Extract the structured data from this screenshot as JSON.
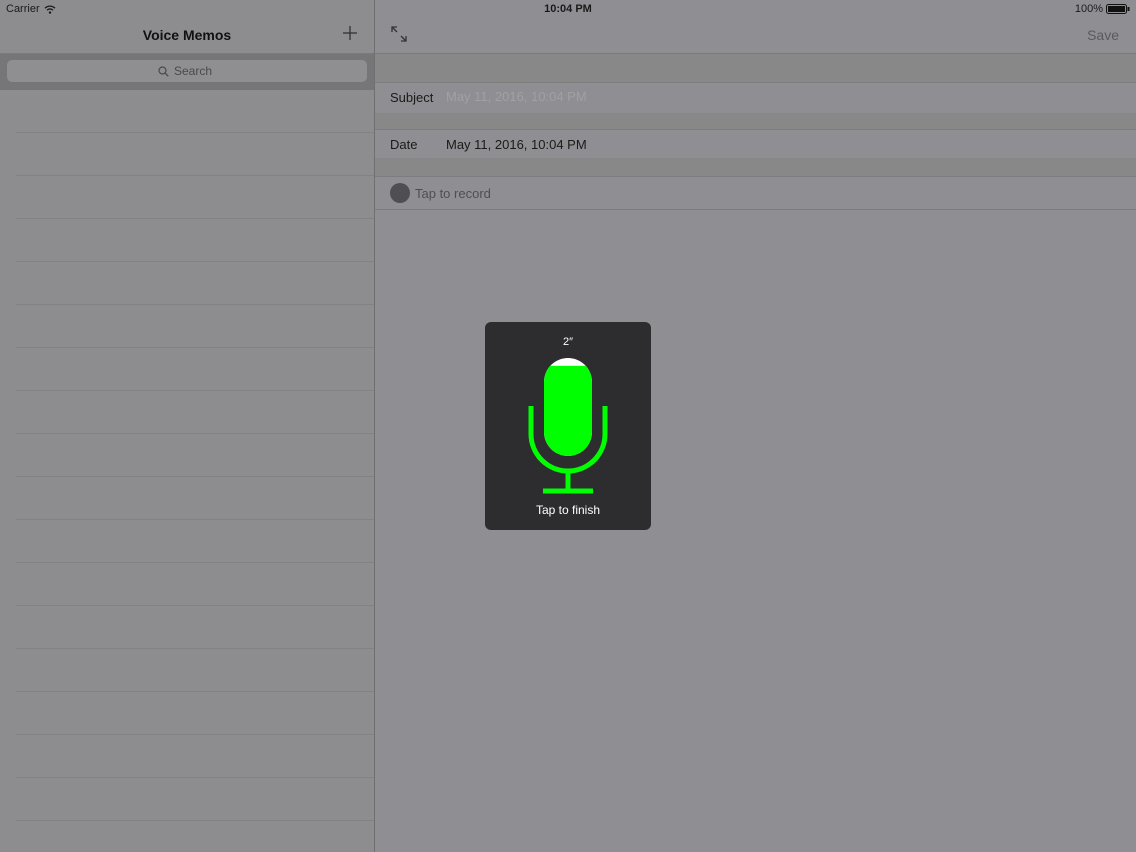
{
  "status_bar": {
    "carrier": "Carrier",
    "time": "10:04 PM",
    "battery": "100%",
    "battery_level": 1.0,
    "wifi_icon": "wifi-icon"
  },
  "sidebar": {
    "title": "Voice Memos",
    "add_icon": "plus-icon",
    "search_placeholder": "Search",
    "search_icon": "magnifier-icon",
    "memos": []
  },
  "detail": {
    "expand_icon": "expand-arrows-icon",
    "save_label": "Save",
    "subject_label": "Subject",
    "subject_placeholder": "May 11, 2016, 10:04 PM",
    "subject_value": "",
    "date_label": "Date",
    "date_value": "May 11, 2016, 10:04 PM",
    "record_label": "Tap to record"
  },
  "recorder": {
    "elapsed": "2″",
    "level": 0.92,
    "finish_label": "Tap to finish",
    "mic_icon": "microphone-icon",
    "accent_color": "#00ff00",
    "panel_color": "#2d2d2f"
  }
}
